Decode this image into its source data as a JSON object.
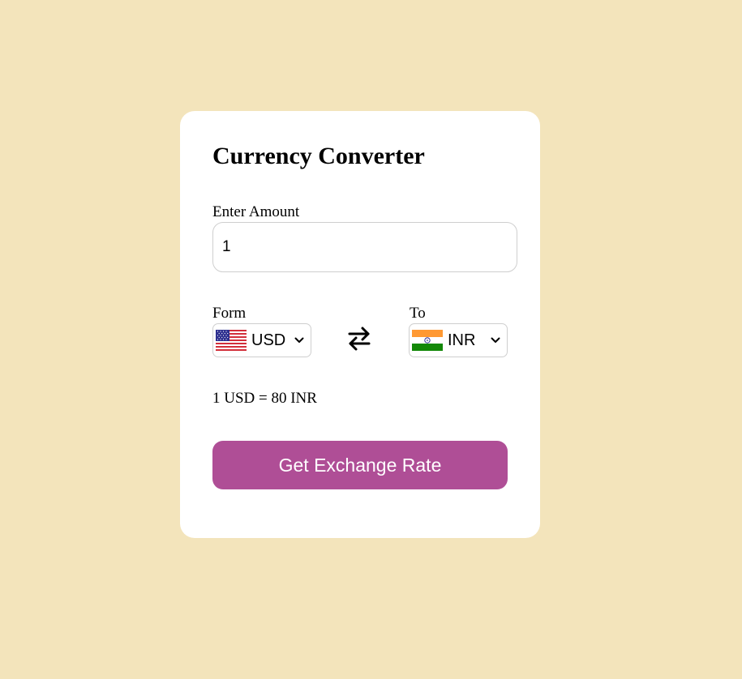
{
  "converter": {
    "title": "Currency Converter",
    "amount_label": "Enter Amount",
    "amount_value": "1",
    "from_label": "Form",
    "to_label": "To",
    "from_currency": {
      "code": "USD",
      "flag_icon": "us-flag-icon"
    },
    "to_currency": {
      "code": "INR",
      "flag_icon": "india-flag-icon"
    },
    "swap_icon": "swap-arrows-icon",
    "rate_text": "1 USD = 80 INR",
    "button_label": "Get Exchange Rate"
  },
  "colors": {
    "page_background": "#f3e4bb",
    "card_background": "#ffffff",
    "button_background": "#af4e96",
    "button_text": "#ffffff",
    "input_border": "#cfcfcf"
  }
}
